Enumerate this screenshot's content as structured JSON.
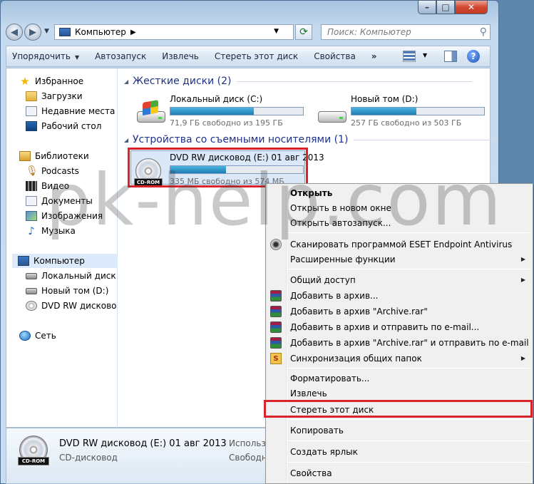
{
  "address": {
    "location": "Компьютер",
    "search_placeholder": "Поиск: Компьютер"
  },
  "toolbar": {
    "organize": "Упорядочить",
    "autorun": "Автозапуск",
    "eject": "Извлечь",
    "erase": "Стереть этот диск",
    "properties": "Свойства",
    "more": "»",
    "help": "?"
  },
  "navpane": {
    "favorites": "Избранное",
    "downloads": "Загрузки",
    "recent": "Недавние места",
    "desktop": "Рабочий стол",
    "libraries": "Библиотеки",
    "podcasts": "Podcasts",
    "video": "Видео",
    "documents": "Документы",
    "images": "Изображения",
    "music": "Музыка",
    "computer": "Компьютер",
    "local_disk": "Локальный диск (С",
    "new_volume": "Новый том (D:)",
    "dvd": "DVD RW дисковод (",
    "network": "Сеть"
  },
  "content": {
    "hdd_group": "Жесткие диски (2)",
    "removable_group": "Устройства со съемными носителями (1)",
    "drives": [
      {
        "name": "Локальный диск (C:)",
        "free": "71,9 ГБ свободно из 195 ГБ",
        "used_fraction": 0.63
      },
      {
        "name": "Новый том (D:)",
        "free": "257 ГБ свободно из 503 ГБ",
        "used_fraction": 0.49
      },
      {
        "name": "DVD RW дисковод (E:) 01 авг 2013",
        "free": "335 МБ свободно из 574 МБ",
        "used_fraction": 0.42,
        "badge": "CD-ROM"
      }
    ]
  },
  "details": {
    "name": "DVD RW дисковод (E:) 01 авг 2013",
    "type": "CD-дисковод",
    "used_label": "Использовано",
    "free_label": "Свободно",
    "badge": "CD-ROM"
  },
  "watermark": "pk-help.com",
  "context_menu": [
    "Открыть",
    "Открыть в новом окне",
    "Открыть автозапуск...",
    "Сканировать программой ESET Endpoint Antivirus",
    "Расширенные функции",
    "Общий доступ",
    "Добавить в архив...",
    "Добавить в архив \"Archive.rar\"",
    "Добавить в архив и отправить по e-mail...",
    "Добавить в архив \"Archive.rar\" и отправить по e-mail",
    "Синхронизация общих папок",
    "Форматировать...",
    "Извлечь",
    "Стереть этот диск",
    "Копировать",
    "Создать ярлык",
    "Свойства"
  ],
  "colors": {
    "highlight": "#d8232a",
    "drive_bar": "#1e7db3"
  }
}
